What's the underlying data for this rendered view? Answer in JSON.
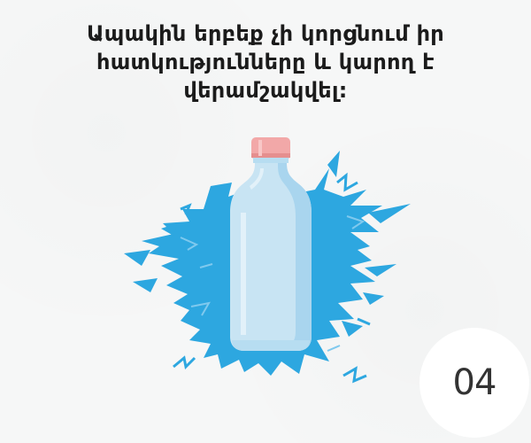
{
  "headline": {
    "line1": "Ապակին երբեք չի կորցնում իր",
    "line2": "հատկությունները և կարող է",
    "line3": "վերամշակվել:"
  },
  "badge": {
    "number": "04"
  },
  "colors": {
    "background": "#f6f7f7",
    "splash_blue": "#2da7e0",
    "bottle_light": "#c8e4f3",
    "bottle_mid": "#a9d5ee",
    "cap_pink": "#f2a8a8",
    "text_dark": "#1b1b1b",
    "badge_white": "#ffffff"
  },
  "icons": {
    "illustration": "water-bottle-on-splash"
  }
}
